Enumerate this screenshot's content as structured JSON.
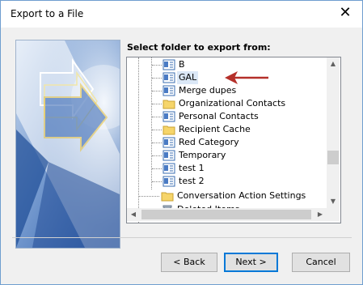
{
  "window": {
    "title": "Export to a File",
    "close_glyph": "✕"
  },
  "prompt": "Select folder to export from:",
  "tree": {
    "items": [
      {
        "label": "B",
        "icon": "contacts-icon",
        "selected": false
      },
      {
        "label": "GAL",
        "icon": "contacts-icon",
        "selected": true
      },
      {
        "label": "Merge dupes",
        "icon": "contacts-icon",
        "selected": false
      },
      {
        "label": "Organizational Contacts",
        "icon": "folder-icon",
        "selected": false
      },
      {
        "label": "Personal Contacts",
        "icon": "contacts-icon",
        "selected": false
      },
      {
        "label": "Recipient Cache",
        "icon": "folder-icon",
        "selected": false
      },
      {
        "label": "Red Category",
        "icon": "contacts-icon",
        "selected": false
      },
      {
        "label": "Temporary",
        "icon": "contacts-icon",
        "selected": false
      },
      {
        "label": "test 1",
        "icon": "contacts-icon",
        "selected": false
      },
      {
        "label": "test 2",
        "icon": "contacts-icon",
        "selected": false
      },
      {
        "label": "Conversation Action Settings",
        "icon": "folder-icon",
        "selected": false
      },
      {
        "label": "Deleted Items",
        "icon": "deleted-items-icon",
        "selected": false
      }
    ]
  },
  "annotation_color": "#b5302a",
  "buttons": {
    "back": "< Back",
    "next": "Next >",
    "cancel": "Cancel"
  }
}
